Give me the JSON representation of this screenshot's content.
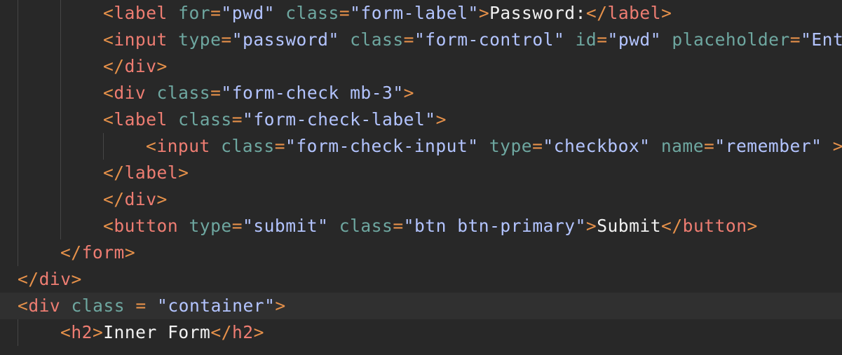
{
  "editor": {
    "colors": {
      "background": "#282828",
      "active_line": "#303030",
      "bracket": "#e6914a",
      "tag": "#ee7d72",
      "attribute": "#6ea7a0",
      "string": "#b3c4ff",
      "text": "#f2f2f2"
    },
    "lines": [
      {
        "indent": 2,
        "tokens": [
          {
            "t": "p",
            "v": "<"
          },
          {
            "t": "tag",
            "v": "label"
          },
          {
            "t": "sp",
            "v": " "
          },
          {
            "t": "attr",
            "v": "for"
          },
          {
            "t": "eq",
            "v": "="
          },
          {
            "t": "str",
            "v": "\"pwd\""
          },
          {
            "t": "sp",
            "v": " "
          },
          {
            "t": "attr",
            "v": "class"
          },
          {
            "t": "eq",
            "v": "="
          },
          {
            "t": "str",
            "v": "\"form-label\""
          },
          {
            "t": "p",
            "v": ">"
          },
          {
            "t": "text",
            "v": "Password:"
          },
          {
            "t": "p",
            "v": "</"
          },
          {
            "t": "tag",
            "v": "label"
          },
          {
            "t": "p",
            "v": ">"
          }
        ]
      },
      {
        "indent": 2,
        "tokens": [
          {
            "t": "p",
            "v": "<"
          },
          {
            "t": "tag",
            "v": "input"
          },
          {
            "t": "sp",
            "v": " "
          },
          {
            "t": "attr",
            "v": "type"
          },
          {
            "t": "eq",
            "v": "="
          },
          {
            "t": "str",
            "v": "\"password\""
          },
          {
            "t": "sp",
            "v": " "
          },
          {
            "t": "attr",
            "v": "class"
          },
          {
            "t": "eq",
            "v": "="
          },
          {
            "t": "str",
            "v": "\"form-control\""
          },
          {
            "t": "sp",
            "v": " "
          },
          {
            "t": "attr",
            "v": "id"
          },
          {
            "t": "eq",
            "v": "="
          },
          {
            "t": "str",
            "v": "\"pwd\""
          },
          {
            "t": "sp",
            "v": " "
          },
          {
            "t": "attr",
            "v": "placeholder"
          },
          {
            "t": "eq",
            "v": "="
          },
          {
            "t": "str",
            "v": "\"Ent"
          }
        ]
      },
      {
        "indent": 2,
        "tokens": [
          {
            "t": "p",
            "v": "</"
          },
          {
            "t": "tag",
            "v": "div"
          },
          {
            "t": "p",
            "v": ">"
          }
        ]
      },
      {
        "indent": 2,
        "tokens": [
          {
            "t": "p",
            "v": "<"
          },
          {
            "t": "tag",
            "v": "div"
          },
          {
            "t": "sp",
            "v": " "
          },
          {
            "t": "attr",
            "v": "class"
          },
          {
            "t": "eq",
            "v": "="
          },
          {
            "t": "str",
            "v": "\"form-check mb-3\""
          },
          {
            "t": "p",
            "v": ">"
          }
        ]
      },
      {
        "indent": 2,
        "tokens": [
          {
            "t": "p",
            "v": "<"
          },
          {
            "t": "tag",
            "v": "label"
          },
          {
            "t": "sp",
            "v": " "
          },
          {
            "t": "attr",
            "v": "class"
          },
          {
            "t": "eq",
            "v": "="
          },
          {
            "t": "str",
            "v": "\"form-check-label\""
          },
          {
            "t": "p",
            "v": ">"
          }
        ]
      },
      {
        "indent": 3,
        "tokens": [
          {
            "t": "p",
            "v": "<"
          },
          {
            "t": "tag",
            "v": "input"
          },
          {
            "t": "sp",
            "v": " "
          },
          {
            "t": "attr",
            "v": "class"
          },
          {
            "t": "eq",
            "v": "="
          },
          {
            "t": "str",
            "v": "\"form-check-input\""
          },
          {
            "t": "sp",
            "v": " "
          },
          {
            "t": "attr",
            "v": "type"
          },
          {
            "t": "eq",
            "v": "="
          },
          {
            "t": "str",
            "v": "\"checkbox\""
          },
          {
            "t": "sp",
            "v": " "
          },
          {
            "t": "attr",
            "v": "name"
          },
          {
            "t": "eq",
            "v": "="
          },
          {
            "t": "str",
            "v": "\"remember\""
          },
          {
            "t": "sp",
            "v": " "
          },
          {
            "t": "p",
            "v": ">"
          }
        ]
      },
      {
        "indent": 2,
        "tokens": [
          {
            "t": "p",
            "v": "</"
          },
          {
            "t": "tag",
            "v": "label"
          },
          {
            "t": "p",
            "v": ">"
          }
        ]
      },
      {
        "indent": 2,
        "tokens": [
          {
            "t": "p",
            "v": "</"
          },
          {
            "t": "tag",
            "v": "div"
          },
          {
            "t": "p",
            "v": ">"
          }
        ]
      },
      {
        "indent": 2,
        "tokens": [
          {
            "t": "p",
            "v": "<"
          },
          {
            "t": "tag",
            "v": "button"
          },
          {
            "t": "sp",
            "v": " "
          },
          {
            "t": "attr",
            "v": "type"
          },
          {
            "t": "eq",
            "v": "="
          },
          {
            "t": "str",
            "v": "\"submit\""
          },
          {
            "t": "sp",
            "v": " "
          },
          {
            "t": "attr",
            "v": "class"
          },
          {
            "t": "eq",
            "v": "="
          },
          {
            "t": "str",
            "v": "\"btn btn-primary\""
          },
          {
            "t": "p",
            "v": ">"
          },
          {
            "t": "text",
            "v": "Submit"
          },
          {
            "t": "p",
            "v": "</"
          },
          {
            "t": "tag",
            "v": "button"
          },
          {
            "t": "p",
            "v": ">"
          }
        ]
      },
      {
        "indent": 1,
        "tokens": [
          {
            "t": "p",
            "v": "</"
          },
          {
            "t": "tag",
            "v": "form"
          },
          {
            "t": "p",
            "v": ">"
          }
        ]
      },
      {
        "indent": 0,
        "tokens": [
          {
            "t": "p",
            "v": "</"
          },
          {
            "t": "tag",
            "v": "div"
          },
          {
            "t": "p",
            "v": ">"
          }
        ]
      },
      {
        "indent": 0,
        "active": true,
        "tokens": [
          {
            "t": "p",
            "v": "<"
          },
          {
            "t": "tag",
            "v": "div"
          },
          {
            "t": "sp",
            "v": " "
          },
          {
            "t": "attr",
            "v": "class"
          },
          {
            "t": "sp",
            "v": " "
          },
          {
            "t": "eq",
            "v": "="
          },
          {
            "t": "sp",
            "v": " "
          },
          {
            "t": "str",
            "v": "\"container\""
          },
          {
            "t": "p",
            "v": ">"
          }
        ]
      },
      {
        "indent": 1,
        "tokens": [
          {
            "t": "p",
            "v": "<"
          },
          {
            "t": "tag",
            "v": "h2"
          },
          {
            "t": "p",
            "v": ">"
          },
          {
            "t": "text",
            "v": "Inner Form"
          },
          {
            "t": "p",
            "v": "</"
          },
          {
            "t": "tag",
            "v": "h2"
          },
          {
            "t": "p",
            "v": ">"
          }
        ]
      }
    ]
  }
}
